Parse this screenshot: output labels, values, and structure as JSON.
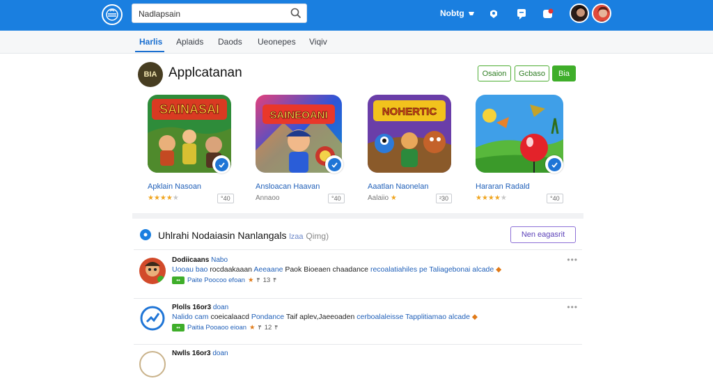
{
  "header": {
    "search_value": "Nadlapsain",
    "link_label": "Nobtg",
    "icons": [
      "logo-icon",
      "search-icon",
      "bell-icon",
      "share-icon",
      "chat-icon",
      "notification-icon"
    ]
  },
  "nav": {
    "tabs": [
      {
        "label": "Harlis",
        "active": true
      },
      {
        "label": "Aplaids",
        "active": false
      },
      {
        "label": "Daods",
        "active": false
      },
      {
        "label": "Ueonepes",
        "active": false
      },
      {
        "label": "Viqiv",
        "active": false
      }
    ]
  },
  "section": {
    "badge": "BIA",
    "title": "Applcatanan",
    "buttons": [
      {
        "label": "Osaion",
        "style": "outline"
      },
      {
        "label": "Gcbaso",
        "style": "outline"
      },
      {
        "label": "Bia",
        "style": "solid"
      }
    ]
  },
  "apps": [
    {
      "art_title": "SAINASAI",
      "name": "Apklain Nasoan",
      "stars": 4,
      "stars_total": 5,
      "rating_text": "",
      "chip": "°40"
    },
    {
      "art_title": "SAINEOANI",
      "name": "Ansloacan Haavan",
      "stars": 0,
      "stars_total": 0,
      "rating_text": "Annaoo",
      "chip": "°40"
    },
    {
      "art_title": "NOHERTIC",
      "name": "Aaatlan Naonelan",
      "stars": 1,
      "stars_total": 1,
      "rating_text": "Aalaiio",
      "chip": "²30"
    },
    {
      "art_title": "",
      "name": "Hararan Radald",
      "stars": 4,
      "stars_total": 5,
      "rating_text": "",
      "chip": "°40"
    }
  ],
  "list": {
    "title": "Uhlrahi Nodaiasin Nanlangals",
    "title_sub": "lzaa",
    "title_light": "Qimg)",
    "more_button": "Nen eagasrit",
    "rows": [
      {
        "title": "Dodiicaans",
        "title_blue": "Nabo",
        "desc_blue1": "Uooau bao",
        "desc_dark1": "rocdaakaaan",
        "desc_blue2": "Aeeaane",
        "desc_dark2": "Paok  Bioeaen  chaadance",
        "desc_blue3": "recoalatiahiles pe",
        "desc_blue4": "Taliagebonai alcade",
        "meta_blue": "Paite  Poocoo efoan",
        "meta_vals": [
          "۴",
          "13",
          "۴"
        ]
      },
      {
        "title": "Plolls  16or3",
        "title_blue": "doan",
        "desc_blue1": "Nalido cam",
        "desc_dark1": "coeicalaacd",
        "desc_blue2": "Pondance",
        "desc_dark2": "Taif  aplev,Jaeeoaden",
        "desc_blue3": "cerboalaleisse",
        "desc_blue4": "Tapplitiamao alcade",
        "meta_blue": "Paitia  Pooaoo eioan",
        "meta_vals": [
          "۴",
          "12",
          "۴"
        ]
      },
      {
        "title": "Nwlls  16or3",
        "title_blue": "doan",
        "desc_blue1": "",
        "desc_dark1": "",
        "desc_blue2": "",
        "desc_dark2": "",
        "desc_blue3": "",
        "desc_blue4": "",
        "meta_blue": "",
        "meta_vals": []
      }
    ]
  },
  "colors": {
    "header_bg": "#1a7fe0",
    "accent_blue": "#1a6fd0",
    "green": "#3fae2a",
    "purple": "#5a3fb8",
    "star": "#f0a520"
  }
}
